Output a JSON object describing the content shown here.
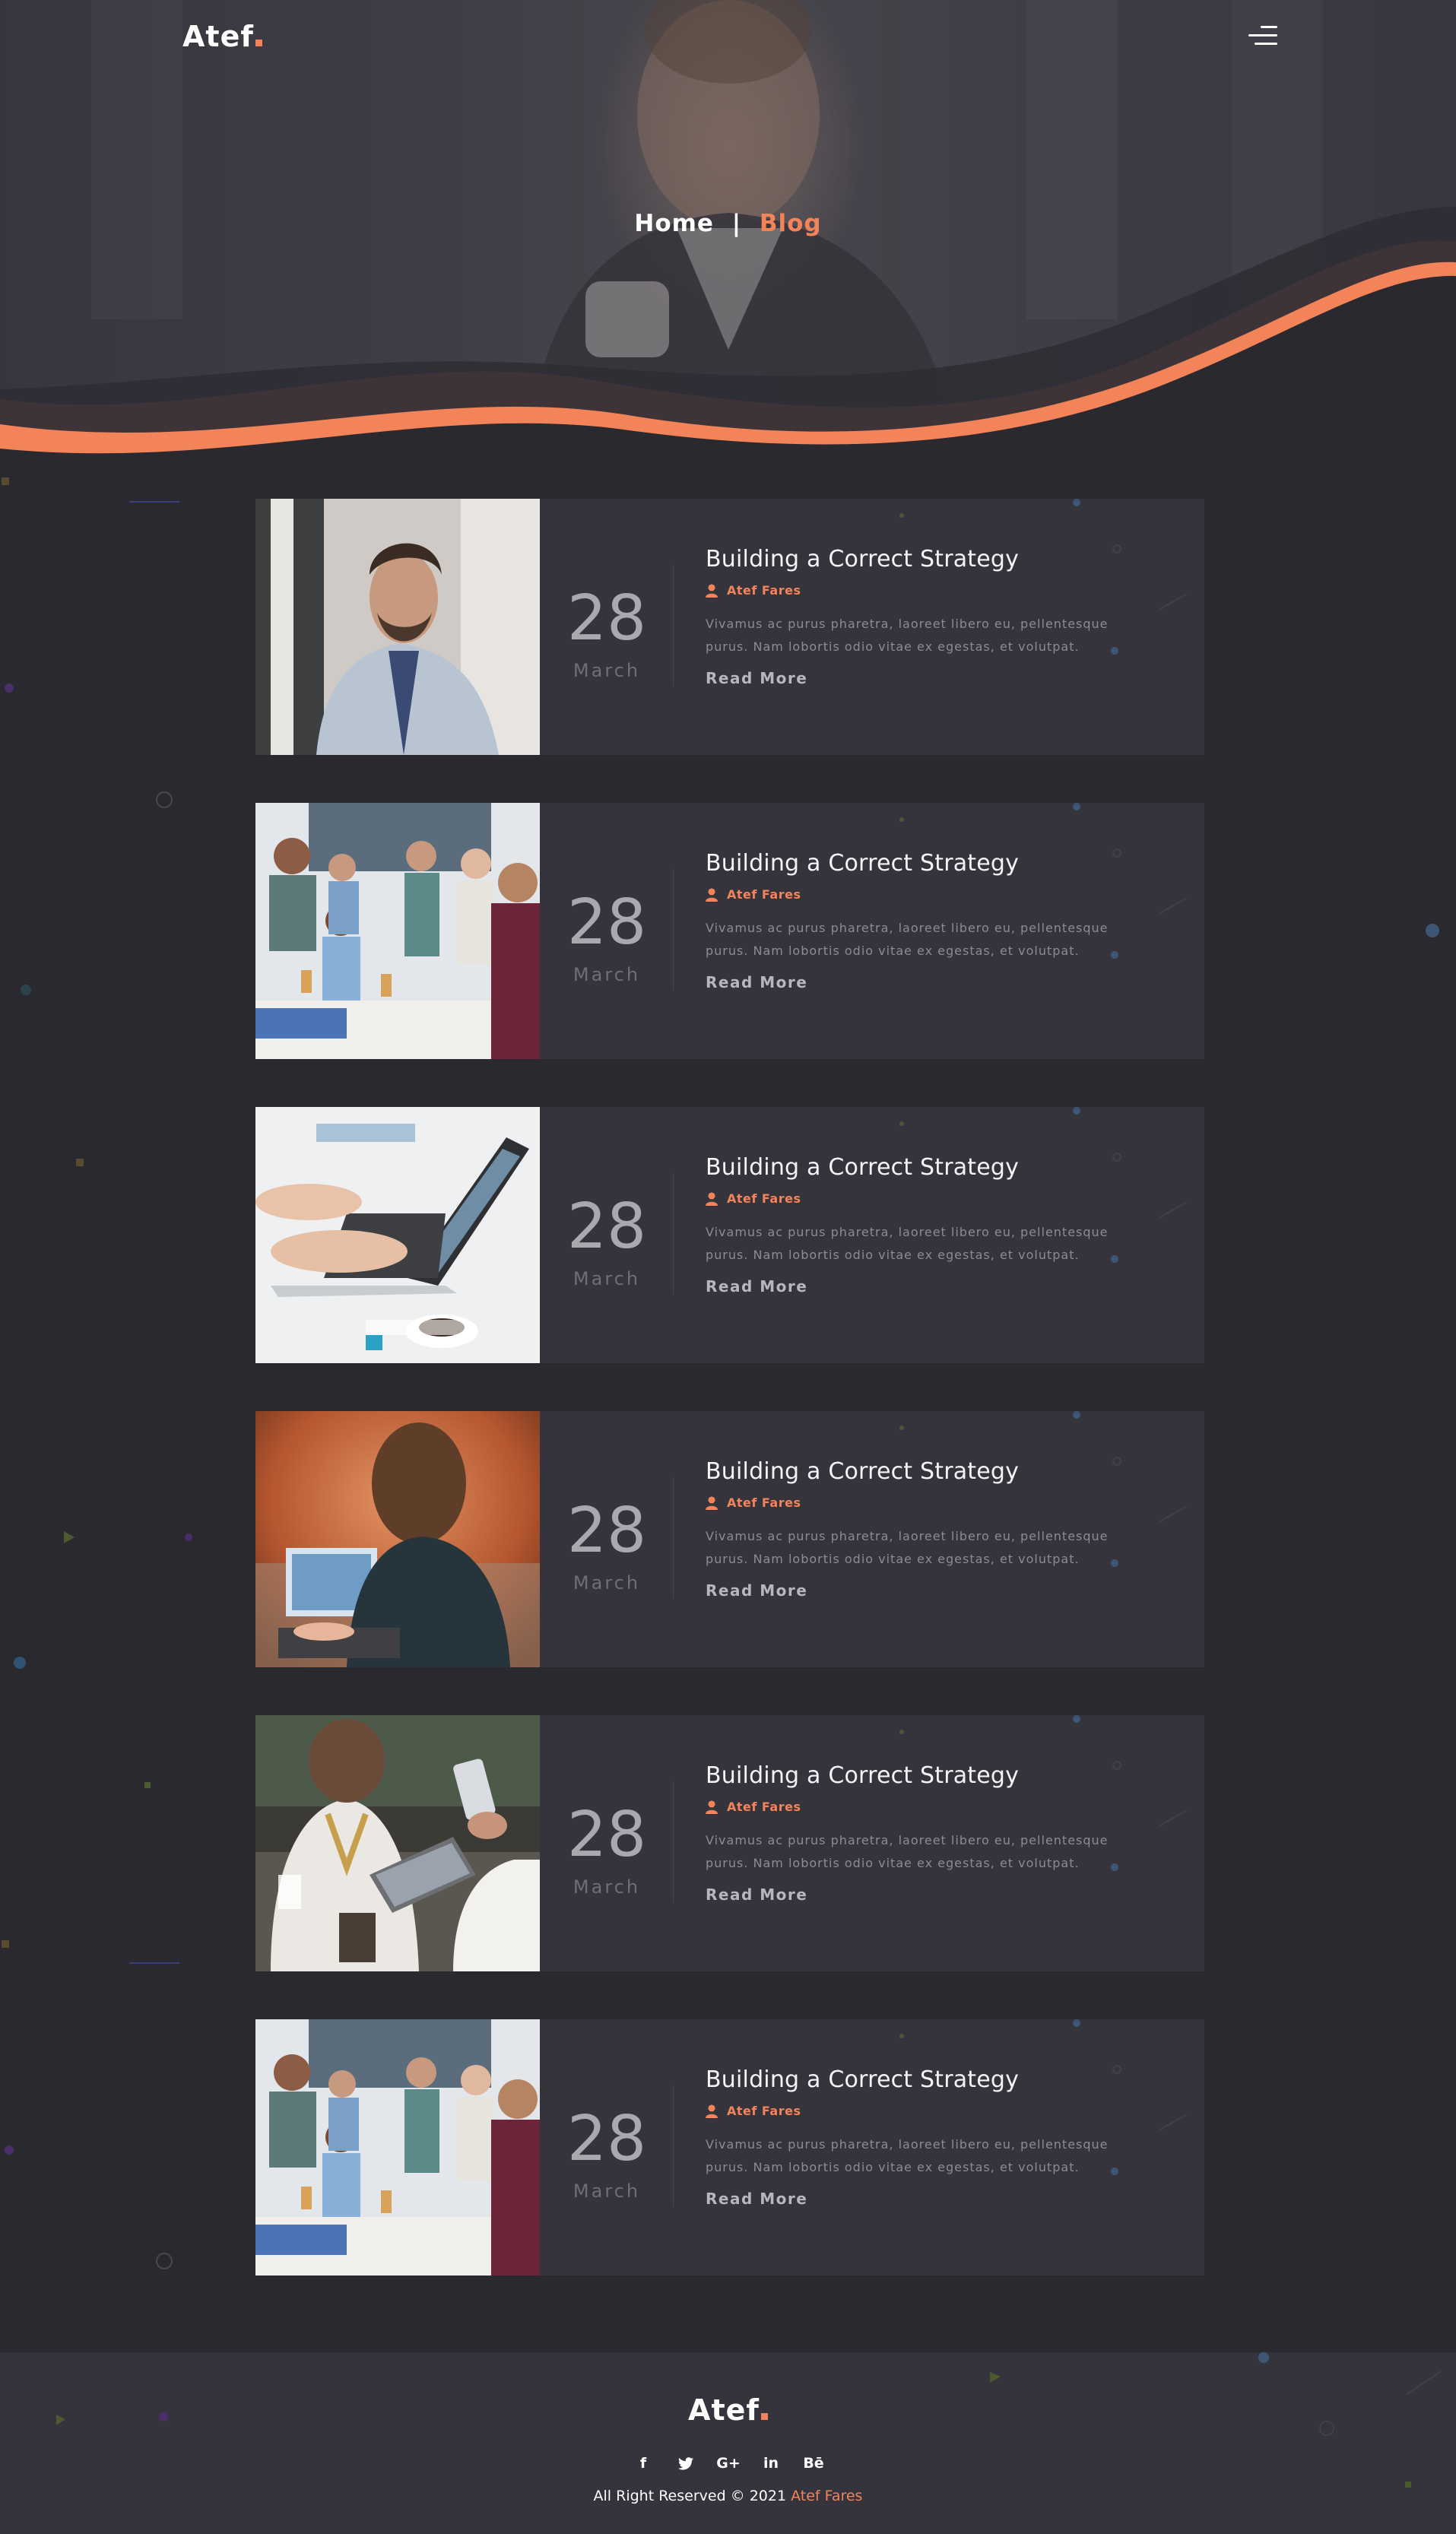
{
  "header": {
    "logo_text": "Atef",
    "menu_icon": "hamburger-menu-icon",
    "breadcrumb": {
      "home": "Home",
      "separator": "|",
      "current": "Blog"
    }
  },
  "colors": {
    "accent": "#f3845a",
    "background": "#2a2930",
    "card": "#35343c"
  },
  "posts": [
    {
      "image": "businessman-portrait-photo",
      "day": "28",
      "month": "March",
      "title": "Building a Correct Strategy",
      "author": "Atef Fares",
      "excerpt_1": "Vivamus ac purus pharetra, laoreet libero eu, pellentesque",
      "excerpt_2": "purus. Nam lobortis odio vitae ex egestas, et volutpat.",
      "read_more": "Read More"
    },
    {
      "image": "team-meeting-photo",
      "day": "28",
      "month": "March",
      "title": "Building a Correct Strategy",
      "author": "Atef Fares",
      "excerpt_1": "Vivamus ac purus pharetra, laoreet libero eu, pellentesque",
      "excerpt_2": "purus. Nam lobortis odio vitae ex egestas, et volutpat.",
      "read_more": "Read More"
    },
    {
      "image": "laptop-typing-photo",
      "day": "28",
      "month": "March",
      "title": "Building a Correct Strategy",
      "author": "Atef Fares",
      "excerpt_1": "Vivamus ac purus pharetra, laoreet libero eu, pellentesque",
      "excerpt_2": "purus. Nam lobortis odio vitae ex egestas, et volutpat.",
      "read_more": "Read More"
    },
    {
      "image": "conference-speaker-photo",
      "day": "28",
      "month": "March",
      "title": "Building a Correct Strategy",
      "author": "Atef Fares",
      "excerpt_1": "Vivamus ac purus pharetra, laoreet libero eu, pellentesque",
      "excerpt_2": "purus. Nam lobortis odio vitae ex egestas, et volutpat.",
      "read_more": "Read More"
    },
    {
      "image": "tablet-coffee-photo",
      "day": "28",
      "month": "March",
      "title": "Building a Correct Strategy",
      "author": "Atef Fares",
      "excerpt_1": "Vivamus ac purus pharetra, laoreet libero eu, pellentesque",
      "excerpt_2": "purus. Nam lobortis odio vitae ex egestas, et volutpat.",
      "read_more": "Read More"
    },
    {
      "image": "team-meeting-photo",
      "day": "28",
      "month": "March",
      "title": "Building a Correct Strategy",
      "author": "Atef Fares",
      "excerpt_1": "Vivamus ac purus pharetra, laoreet libero eu, pellentesque",
      "excerpt_2": "purus. Nam lobortis odio vitae ex egestas, et volutpat.",
      "read_more": "Read More"
    }
  ],
  "footer": {
    "logo_text": "Atef",
    "socials": [
      {
        "icon": "facebook-icon",
        "glyph": "f"
      },
      {
        "icon": "twitter-icon",
        "glyph": "t"
      },
      {
        "icon": "google-plus-icon",
        "glyph": "G+"
      },
      {
        "icon": "linkedin-icon",
        "glyph": "in"
      },
      {
        "icon": "behance-icon",
        "glyph": "Bē"
      }
    ],
    "copyright_prefix": "All Right Reserved © 2021",
    "copyright_name": "Atef Fares"
  }
}
